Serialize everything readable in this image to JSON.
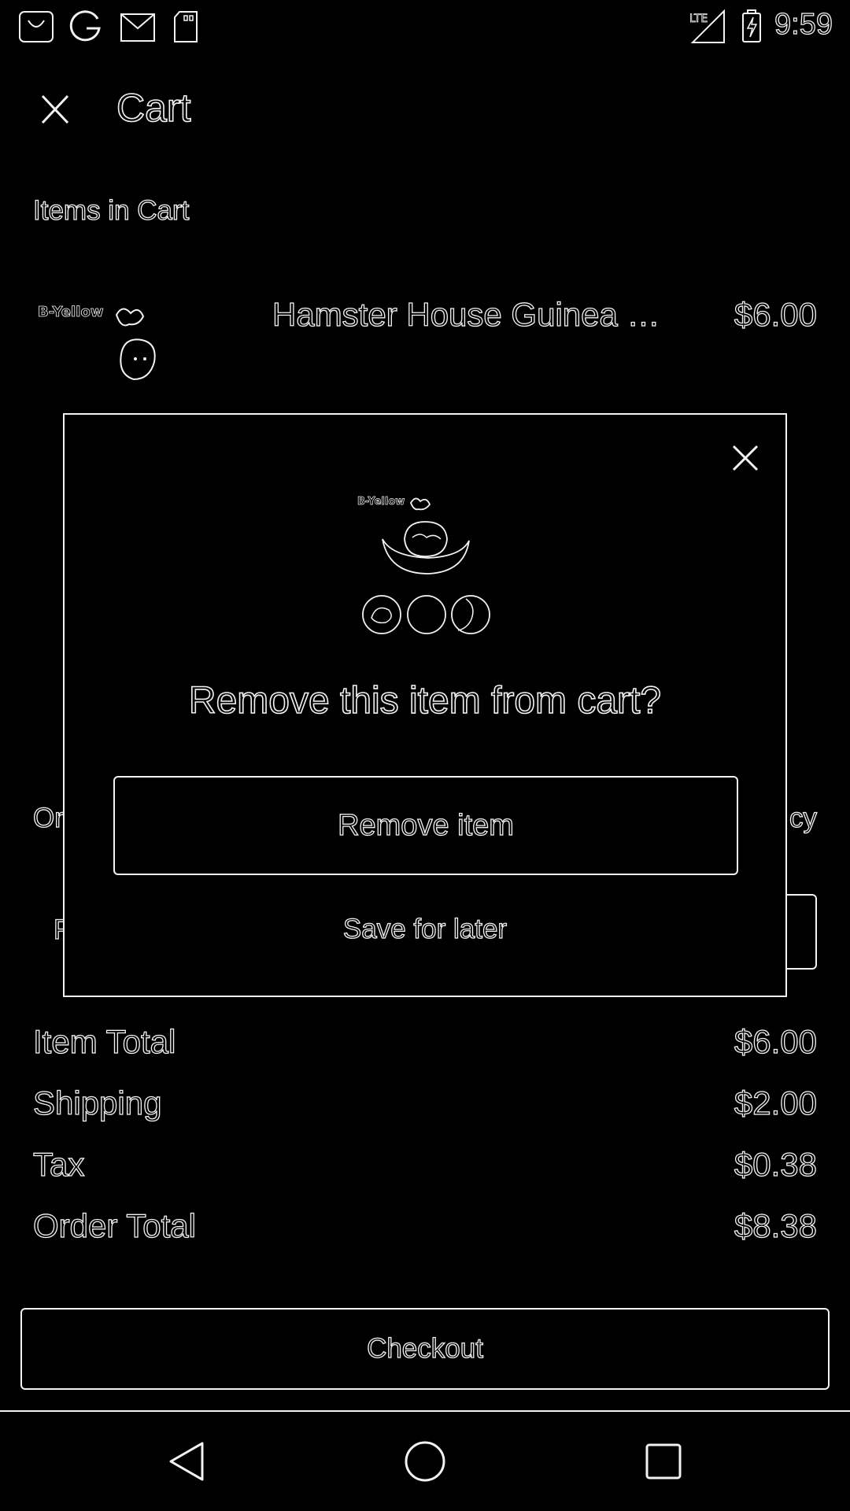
{
  "status_bar": {
    "time": "9:59",
    "left_icons": [
      "bag-icon",
      "google-icon",
      "gmail-icon",
      "sd-card-icon"
    ],
    "right_icons": [
      "lte-signal-icon",
      "battery-charging-icon"
    ]
  },
  "app_bar": {
    "title": "Cart",
    "close_icon": "close-icon"
  },
  "section_title": "Items in Cart",
  "cart_item": {
    "name": "Hamster House Guinea Pi...",
    "price": "$6.00",
    "brand_text": "B-Yellow"
  },
  "background_fragments": {
    "left_row": "Or",
    "right_row": "cy",
    "left_row2": "F"
  },
  "summary": [
    {
      "label": "Item Total",
      "value": "$6.00"
    },
    {
      "label": "Shipping",
      "value": "$2.00"
    },
    {
      "label": "Tax",
      "value": "$0.38"
    },
    {
      "label": "Order Total",
      "value": "$8.38"
    }
  ],
  "checkout_label": "Checkout",
  "dialog": {
    "title": "Remove this item from cart?",
    "brand_text": "B-Yellow",
    "remove_label": "Remove item",
    "save_label": "Save for later"
  },
  "nav_bar": {
    "icons": [
      "back-icon",
      "home-icon",
      "recents-icon"
    ]
  }
}
